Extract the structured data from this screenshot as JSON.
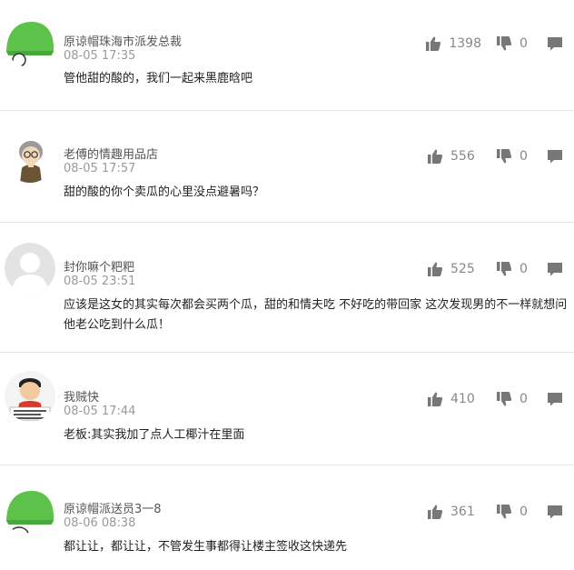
{
  "comments": [
    {
      "username": "原谅帽珠海市派发总裁",
      "time": "08-05 17:35",
      "text": "管他甜的酸的，我们一起来黑鹿晗吧",
      "likes": "1398",
      "dislikes": "0",
      "avatar": "green-hat-avatar"
    },
    {
      "username": "老傅的情趣用品店",
      "time": "08-05 17:57",
      "text": "甜的酸的你个卖瓜的心里没点避暑吗？",
      "likes": "556",
      "dislikes": "0",
      "avatar": "cartoon-old-man-avatar"
    },
    {
      "username": "封你嘛个粑粑",
      "time": "08-05 23:51",
      "text": "应该是这女的其实每次都会买两个瓜，甜的和情夫吃 不好吃的带回家 这次发现男的不一样就想问他老公吃到什么瓜！",
      "likes": "525",
      "dislikes": "0",
      "avatar": "default-gray-avatar"
    },
    {
      "username": "我贼快",
      "time": "08-05 17:44",
      "text": "老板:其实我加了点人工椰汁在里面",
      "likes": "410",
      "dislikes": "0",
      "avatar": "cartoon-meme-avatar"
    },
    {
      "username": "原谅帽派送员3一8",
      "time": "08-06 08:38",
      "text": "都让让，都让让，不管发生事都得让楼主签收这快递先",
      "likes": "361",
      "dislikes": "0",
      "avatar": "green-hat-avatar"
    }
  ],
  "colors": {
    "text_primary": "#222222",
    "text_meta": "#999999",
    "icon": "#777777",
    "divider": "#e8e8e8",
    "green_hat": "#5cc24a"
  },
  "icons": {
    "like": "thumbs-up-icon",
    "dislike": "thumbs-down-icon",
    "reply": "comment-bubble-icon"
  }
}
